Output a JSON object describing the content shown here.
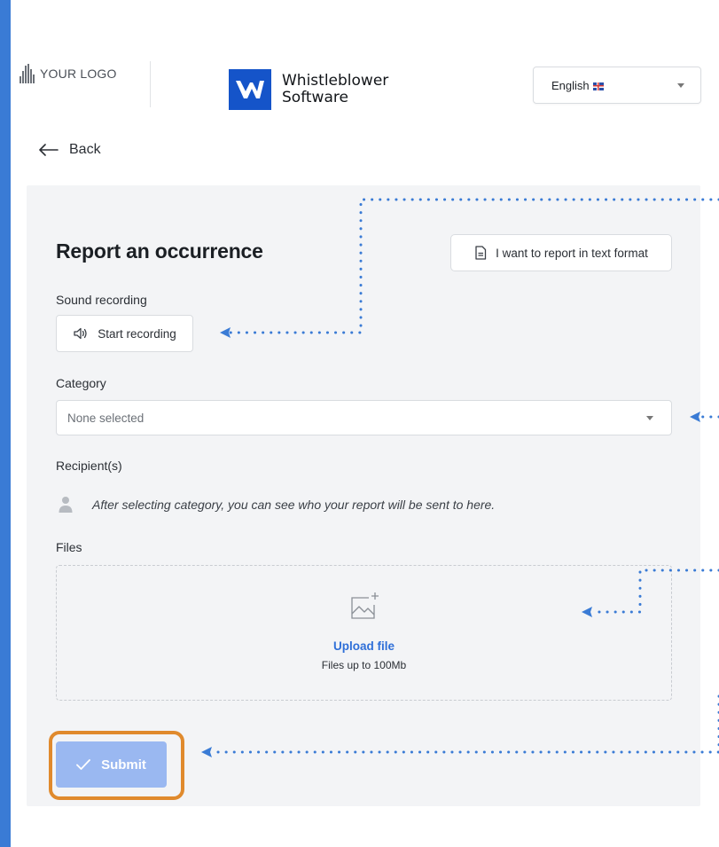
{
  "header": {
    "your_logo_text": "YOUR LOGO",
    "brand_line1": "Whistleblower",
    "brand_line2": "Software",
    "language": {
      "selected": "English"
    }
  },
  "nav": {
    "back_label": "Back"
  },
  "form": {
    "title": "Report an occurrence",
    "text_format_button": "I want to report in text format",
    "sound_recording_label": "Sound recording",
    "start_recording_button": "Start recording",
    "category_label": "Category",
    "category_value": "None selected",
    "recipients_label": "Recipient(s)",
    "recipients_hint": "After selecting category, you can see who your report will be sent to here.",
    "files_label": "Files",
    "upload_link": "Upload file",
    "upload_limit": "Files up to 100Mb",
    "submit_button": "Submit"
  },
  "colors": {
    "frame_blue": "#3a7bd5",
    "brand_blue": "#1554c9",
    "panel_bg": "#f3f4f6",
    "submit_bg": "#9ab8f1",
    "highlight_orange": "#e08a2d",
    "annotation_blue": "#3a7bd5",
    "link_blue": "#2f6fd8"
  },
  "icons": {
    "back": "arrow-left-icon",
    "text_format": "document-icon",
    "recording": "speaker-icon",
    "recipient": "user-icon",
    "upload": "image-add-icon",
    "submit": "check-icon",
    "dropdown": "chevron-down-icon"
  }
}
